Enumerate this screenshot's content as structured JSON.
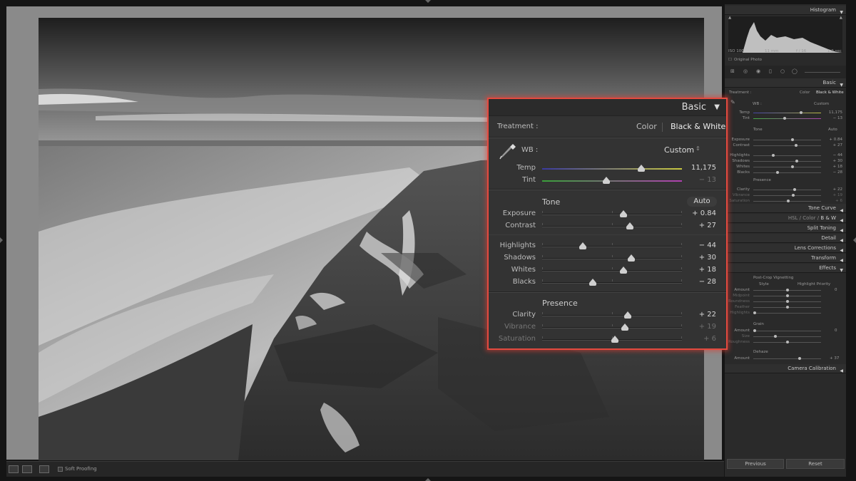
{
  "histogram": {
    "title": "Histogram",
    "iso": "ISO 100",
    "focal": "11 mm",
    "aperture": "f / 16",
    "shutter": "1.2 sec",
    "original_label": "Original Photo"
  },
  "basic_panel": {
    "title": "Basic",
    "treatment_label": "Treatment :",
    "treatment_color": "Color",
    "treatment_bw": "Black & White",
    "wb_label": "WB :",
    "wb_value": "Custom",
    "tone_label": "Tone",
    "auto_label": "Auto",
    "presence_label": "Presence",
    "sliders": [
      {
        "name": "Temp",
        "value": "11,175",
        "pos": 0.71,
        "group": "wb"
      },
      {
        "name": "Tint",
        "value": "− 13",
        "pos": 0.46,
        "group": "wb",
        "dim_value": true
      },
      {
        "name": "Exposure",
        "value": "+ 0.84",
        "pos": 0.58,
        "group": "tone"
      },
      {
        "name": "Contrast",
        "value": "+ 27",
        "pos": 0.63,
        "group": "tone"
      },
      {
        "name": "Highlights",
        "value": "− 44",
        "pos": 0.29,
        "group": "tone2"
      },
      {
        "name": "Shadows",
        "value": "+ 30",
        "pos": 0.64,
        "group": "tone2"
      },
      {
        "name": "Whites",
        "value": "+ 18",
        "pos": 0.58,
        "group": "tone2"
      },
      {
        "name": "Blacks",
        "value": "− 28",
        "pos": 0.36,
        "group": "tone2"
      },
      {
        "name": "Clarity",
        "value": "+ 22",
        "pos": 0.61,
        "group": "presence"
      },
      {
        "name": "Vibrance",
        "value": "+ 19",
        "pos": 0.59,
        "group": "presence",
        "dim": true
      },
      {
        "name": "Saturation",
        "value": "+ 6",
        "pos": 0.52,
        "group": "presence",
        "dim": true
      }
    ]
  },
  "right_panel": {
    "basic": "Basic",
    "treatment": "Treatment :",
    "color": "Color",
    "bw": "Black & White",
    "wb": "WB :",
    "custom": "Custom",
    "tone": "Tone",
    "auto": "Auto",
    "presence": "Presence",
    "mini_sliders": [
      {
        "name": "Temp",
        "value": "11,175"
      },
      {
        "name": "Tint",
        "value": "− 13"
      },
      {
        "name": "Exposure",
        "value": "+ 0.84"
      },
      {
        "name": "Contrast",
        "value": "+ 27"
      },
      {
        "name": "Highlights",
        "value": "− 44"
      },
      {
        "name": "Shadows",
        "value": "+ 30"
      },
      {
        "name": "Whites",
        "value": "+ 18"
      },
      {
        "name": "Blacks",
        "value": "− 28"
      },
      {
        "name": "Clarity",
        "value": "+ 22"
      },
      {
        "name": "Vibrance",
        "value": "+ 19"
      },
      {
        "name": "Saturation",
        "value": "+ 6"
      }
    ],
    "tone_curve": "Tone Curve",
    "hsl": "HSL",
    "hsl_color": "Color",
    "hsl_bw": "B & W",
    "split_toning": "Split Toning",
    "detail": "Detail",
    "lens_corrections": "Lens Corrections",
    "transform": "Transform",
    "effects": "Effects",
    "post_crop": "Post-Crop Vignetting",
    "style_label": "Style",
    "style_value": "Highlight Priority",
    "vig_amount": "Amount",
    "vig_amount_val": "0",
    "vig_midpoint": "Midpoint",
    "vig_roundness": "Roundness",
    "vig_feather": "Feather",
    "vig_highlights": "Highlights",
    "grain": "Grain",
    "grain_amount": "Amount",
    "grain_amount_val": "0",
    "grain_size": "Size",
    "grain_roughness": "Roughness",
    "dehaze": "Dehaze",
    "dehaze_amount": "Amount",
    "dehaze_val": "+ 37",
    "camera_calibration": "Camera Calibration",
    "previous": "Previous",
    "reset": "Reset"
  },
  "toolbar": {
    "soft_proofing": "Soft Proofing"
  }
}
